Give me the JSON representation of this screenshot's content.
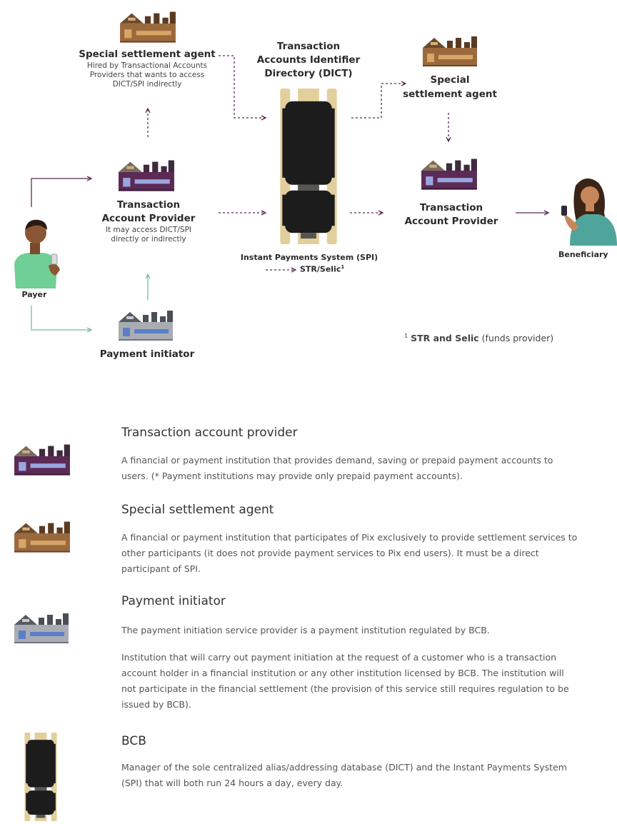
{
  "diagram": {
    "ssa_left": {
      "title": "Special settlement agent",
      "desc": "Hired by Transactional Accounts\nProviders that wants to access\nDICT/SPI indirectly"
    },
    "dict_title": "Transaction\nAccounts Identifier\nDirectory (DICT)",
    "ssa_right_title": "Special\nsettlement agent",
    "tap_left": {
      "title": "Transaction\nAccount Provider",
      "desc": "It may access DICT/SPI\ndirectly or indirectly"
    },
    "tap_right_title": "Transaction\nAccount Provider",
    "payer_label": "Payer",
    "beneficiary_label": "Beneficiary",
    "payment_initiator_label": "Payment initiator",
    "spi_label": "Instant Payments System (SPI)",
    "str_selic_label": "STR/Selic",
    "str_selic_sup": "1",
    "footnote": {
      "sup": "1",
      "bold": "STR and Selic",
      "rest": "(funds provider)"
    }
  },
  "legend": [
    {
      "icon": "purple-building-icon",
      "title": "Transaction account provider",
      "text": "A financial or payment institution that provides demand, saving or prepaid payment accounts to\nusers. (* Payment institutions may provide only prepaid payment accounts)."
    },
    {
      "icon": "brown-building-icon",
      "title": "Special settlement agent",
      "text": "A financial or payment institution that participates of Pix exclusively to provide settlement services to\nother participants (it does not provide payment services to Pix end users). It must be a direct\nparticipant of SPI."
    },
    {
      "icon": "gray-building-icon",
      "title": "Payment initiator",
      "text": "The payment initiation service provider is a payment institution regulated by BCB.",
      "text2": "Institution that will carry out payment initiation at the request of a customer who is a transaction\naccount holder in a financial institution or any other institution licensed by BCB. The institution will\nnot participate in the financial settlement (the provision of this service still requires regulation to be\nissued by BCB)."
    },
    {
      "icon": "bcb-icon",
      "title": "BCB",
      "text": "Manager of the sole centralized alias/addressing database (DICT) and the Instant Payments System\n(SPI) that will both run 24 hours a day, every day."
    }
  ],
  "colors": {
    "purple": "#5b2a55",
    "brown": "#9a6a3d",
    "gray": "#6f7580",
    "green": "#6fbf9b",
    "tan": "#e2cf9c",
    "black": "#1c1c1c"
  }
}
